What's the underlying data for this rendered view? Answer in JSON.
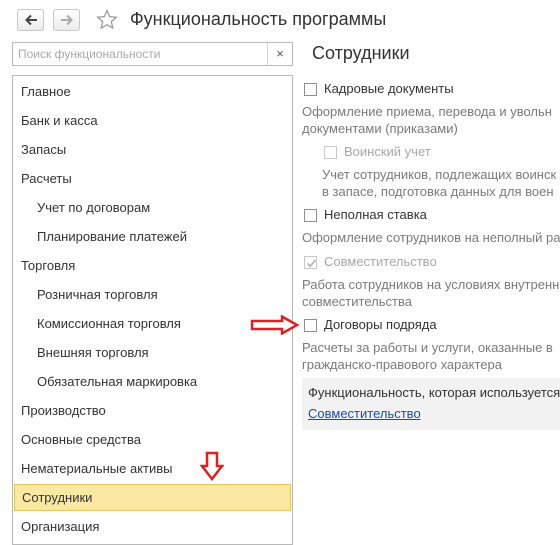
{
  "window": {
    "title": "Функциональность программы"
  },
  "search": {
    "placeholder": "Поиск функциональности",
    "value": "",
    "clear_label": "×"
  },
  "sidebar": {
    "items": [
      {
        "label": "Главное",
        "level": 0
      },
      {
        "label": "Банк и касса",
        "level": 0
      },
      {
        "label": "Запасы",
        "level": 0
      },
      {
        "label": "Расчеты",
        "level": 0
      },
      {
        "label": "Учет по договорам",
        "level": 1
      },
      {
        "label": "Планирование платежей",
        "level": 1
      },
      {
        "label": "Торговля",
        "level": 0
      },
      {
        "label": "Розничная торговля",
        "level": 1
      },
      {
        "label": "Комиссионная торговля",
        "level": 1
      },
      {
        "label": "Внешняя торговля",
        "level": 1
      },
      {
        "label": "Обязательная маркировка",
        "level": 1
      },
      {
        "label": "Производство",
        "level": 0
      },
      {
        "label": "Основные средства",
        "level": 0
      },
      {
        "label": "Нематериальные активы",
        "level": 0
      },
      {
        "label": "Сотрудники",
        "level": 0,
        "selected": true
      },
      {
        "label": "Организация",
        "level": 0
      }
    ]
  },
  "main": {
    "title": "Сотрудники",
    "options": [
      {
        "label": "Кадровые документы",
        "checked": false,
        "disabled": false,
        "description": [
          "Оформление приема, перевода и увольн",
          "документами (приказами)"
        ]
      },
      {
        "label": "Воинский учет",
        "checked": false,
        "disabled": true,
        "description": [
          "Учет сотрудников, подлежащих воинск",
          "в запасе, подготовка данных для воен"
        ]
      },
      {
        "label": "Неполная ставка",
        "checked": false,
        "disabled": false,
        "description": [
          "Оформление сотрудников на неполный ра"
        ]
      },
      {
        "label": "Совместительство",
        "checked": true,
        "disabled": true,
        "description": [
          "Работа сотрудников на условиях внутренн",
          "совместительства"
        ]
      },
      {
        "label": "Договоры подряда",
        "checked": false,
        "disabled": false,
        "description": [
          "Расчеты за работы и услуги, оказанные в",
          "гражданско-правового характера"
        ]
      }
    ],
    "info": {
      "text": "Функциональность, которая используется",
      "link": "Совместительство"
    }
  },
  "colors": {
    "selection_bg": "#fbe9a3",
    "selection_border": "#e6c85a",
    "annotation_arrow": "#e02020",
    "link": "#1a4fa8"
  }
}
